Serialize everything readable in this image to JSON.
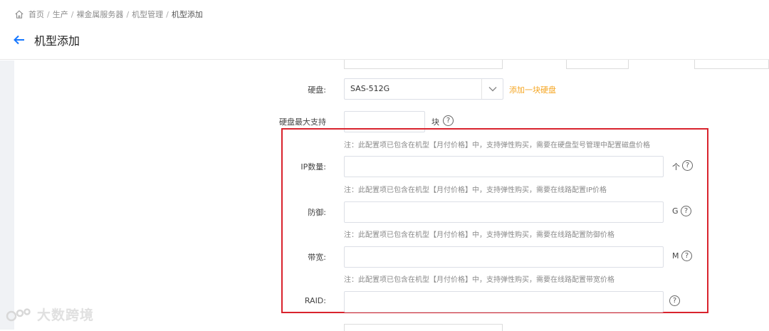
{
  "breadcrumb": {
    "items": [
      "首页",
      "生产",
      "裸金属服务器",
      "机型管理",
      "机型添加"
    ],
    "separator": "/"
  },
  "page": {
    "title": "机型添加"
  },
  "form": {
    "disk": {
      "label": "硬盘:",
      "value": "SAS-512G",
      "add_link": "添加一块硬盘"
    },
    "disk_max": {
      "label": "硬盘最大支持",
      "value": "",
      "unit": "块",
      "note": "注：此配置项已包含在机型【月付价格】中，支持弹性购买，需要在硬盘型号管理中配置磁盘价格"
    },
    "ip_count": {
      "label": "IP数量:",
      "value": "",
      "unit": "个",
      "note": "注：此配置项已包含在机型【月付价格】中，支持弹性购买，需要在线路配置IP价格"
    },
    "defense": {
      "label": "防御:",
      "value": "",
      "unit": "G",
      "note": "注：此配置项已包含在机型【月付价格】中，支持弹性购买，需要在线路配置防御价格"
    },
    "bandwidth": {
      "label": "带宽:",
      "value": "",
      "unit": "M",
      "note": "注：此配置项已包含在机型【月付价格】中，支持弹性购买，需要在线路配置带宽价格"
    },
    "raid": {
      "label": "RAID:",
      "value": ""
    }
  },
  "help_glyph": "?",
  "watermark": {
    "text": "大数跨境"
  },
  "colors": {
    "accent": "#1677ff",
    "highlight_border": "#d9232d",
    "link_orange": "#f5a623"
  },
  "icons": [
    "home-icon",
    "back-arrow-icon",
    "chevron-down-icon",
    "help-icon"
  ]
}
